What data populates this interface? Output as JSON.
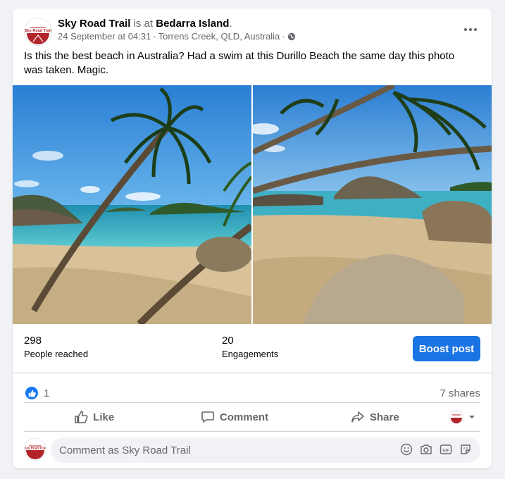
{
  "post": {
    "author": "Sky Road Trail",
    "is_at": "is at",
    "location": "Bedarra Island",
    "period": ".",
    "timestamp": "24 September at 04:31",
    "place": "Torrens Creek, QLD, Australia",
    "separator": "·",
    "text": "Is this the best beach in Australia? Had a swim at this Durillo Beach the same day this photo was taken. Magic."
  },
  "stats": {
    "reached_value": "298",
    "reached_label": "People reached",
    "engagements_value": "20",
    "engagements_label": "Engagements",
    "boost_label": "Boost post"
  },
  "reactions": {
    "like_count": "1",
    "shares": "7 shares"
  },
  "actions": {
    "like": "Like",
    "comment": "Comment",
    "share": "Share"
  },
  "comment": {
    "placeholder": "Comment as Sky Road Trail"
  },
  "colors": {
    "primary": "#1b74e4",
    "like_blue": "#1877f2",
    "secondary_text": "#65676b",
    "brand_red": "#b3242a"
  },
  "icons": [
    "more-icon",
    "globe-icon",
    "like-icon",
    "comment-icon",
    "share-icon",
    "chevron-down-icon",
    "emoji-icon",
    "camera-icon",
    "gif-icon",
    "sticker-icon"
  ]
}
